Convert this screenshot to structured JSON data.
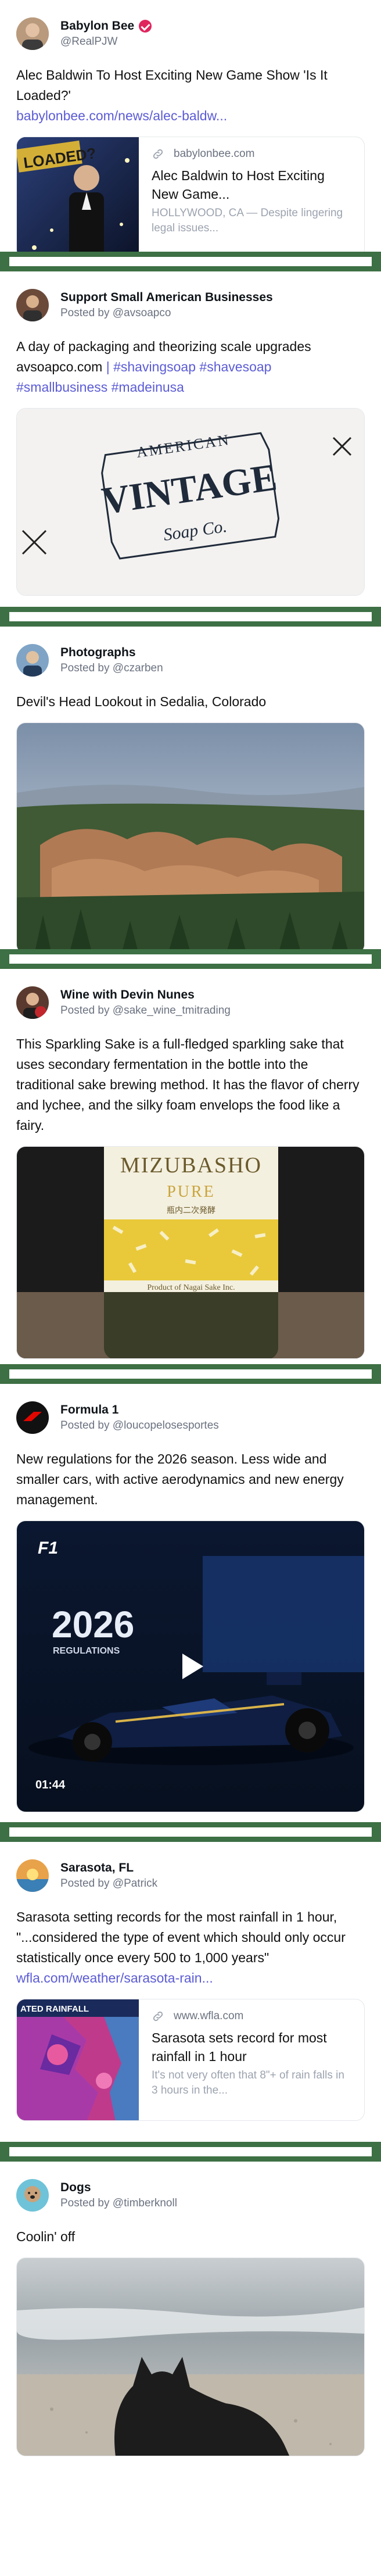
{
  "posts": [
    {
      "name": "Babylon Bee",
      "handle": "@RealPJW",
      "text": "Alec Baldwin To Host Exciting New Game Show 'Is It Loaded?'",
      "link": "babylonbee.com/news/alec-baldw...",
      "card": {
        "domain": "babylonbee.com",
        "title": "Alec Baldwin to Host Exciting New Game...",
        "desc": "HOLLYWOOD, CA — Despite lingering legal issues...",
        "thumb_text": "LOADED?"
      }
    },
    {
      "name": "Support Small American Businesses",
      "handle": "Posted by @avsoapco",
      "text_lead": "A day of packaging and theorizing scale upgrades",
      "link": "avsoapco.com",
      "divider": "|",
      "tags": [
        "#shavingsoap",
        "#shavesoap",
        "#smallbusiness",
        "#madeinusa"
      ],
      "image_text": {
        "top": "AMERICAN",
        "main": "VINTAGE",
        "bottom": "Soap Co."
      }
    },
    {
      "name": "Photographs",
      "handle": "Posted by @czarben",
      "text": "Devil's Head Lookout in Sedalia, Colorado"
    },
    {
      "name": "Wine with Devin Nunes",
      "handle": "Posted by @sake_wine_tmitrading",
      "text": "This Sparkling Sake is a full-fledged sparkling sake that uses secondary fermentation in the bottle into the traditional sake brewing method. It has the flavor of cherry and lychee, and the silky foam envelops the food like a fairy.",
      "image_text": {
        "brand": "MIZUBASHO",
        "sub": "PURE",
        "jp": "瓶内二次発酵",
        "footer": "Product of Nagai Sake Inc."
      }
    },
    {
      "name": "Formula 1",
      "handle": "Posted by @loucopelosesportes",
      "text": "New regulations for the 2026 season. Less wide and smaller cars, with active aerodynamics and new energy management.",
      "video": {
        "duration": "01:44",
        "logo": "F1",
        "big": "2026",
        "small": "REGULATIONS"
      }
    },
    {
      "name": "Sarasota, FL",
      "handle": "Posted by @Patrick",
      "text": "Sarasota setting records for the most rainfall in 1 hour, \"...considered the type of event which should only occur statistically once every 500 to 1,000 years\"",
      "link": "wfla.com/weather/sarasota-rain...",
      "card": {
        "domain": "www.wfla.com",
        "title": "Sarasota sets record for most rainfall in 1 hour",
        "desc": "It's not very often that 8\"+ of rain falls in 3 hours in the...",
        "thumb_text": "ATED RAINFALL"
      }
    },
    {
      "name": "Dogs",
      "handle": "Posted by @timberknoll",
      "text": "Coolin' off"
    }
  ],
  "colors": {
    "separator": "#3d7044",
    "link": "#5b5bd6",
    "verified": "#e0245e"
  }
}
